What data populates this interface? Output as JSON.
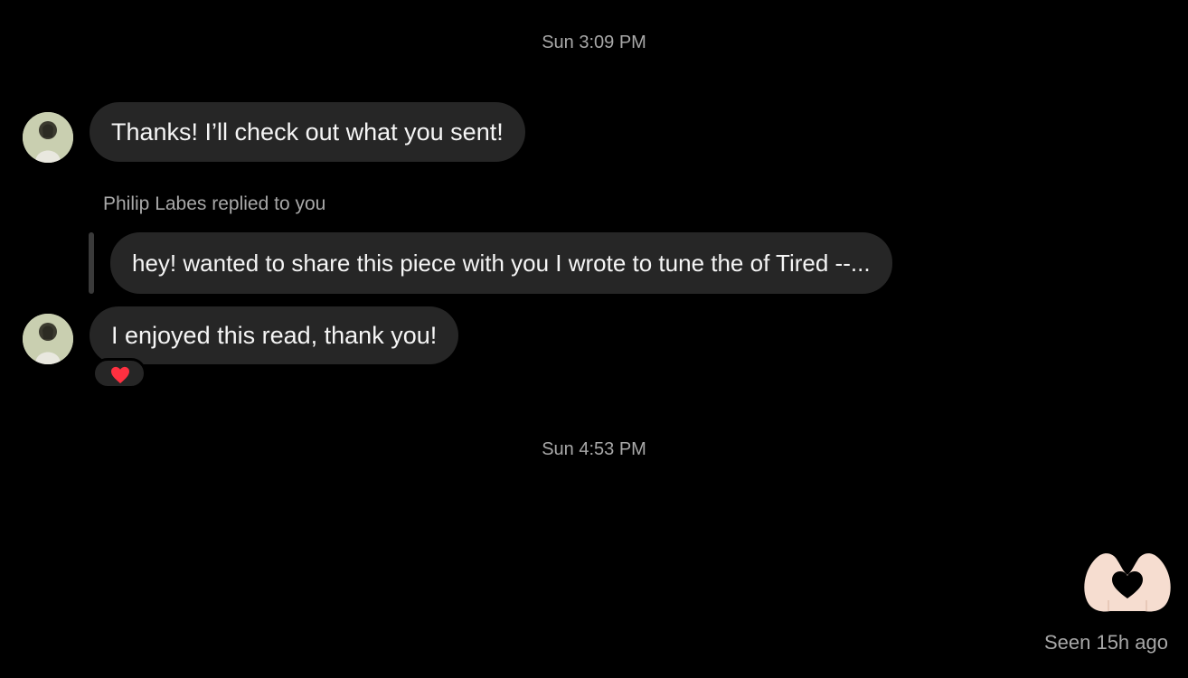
{
  "conversation": {
    "timestamps": [
      "Sun 3:09 PM",
      "Sun 4:53 PM"
    ],
    "messages": [
      {
        "text": "Thanks! I’ll check out what you sent!"
      },
      {
        "reply_label": "Philip Labes replied to you",
        "quoted_text": "hey! wanted to share this piece with you I wrote to tune the of Tired --..."
      },
      {
        "text": "I enjoyed this read, thank you!",
        "reaction": "heart"
      }
    ],
    "sent_sticker": "heart-hands",
    "seen_status": "Seen 15h ago"
  },
  "colors": {
    "background": "#000000",
    "bubble": "#262626",
    "muted_text": "#a8a8a8",
    "reaction_heart": "#ff3040",
    "hands": "#f6ddd0"
  }
}
